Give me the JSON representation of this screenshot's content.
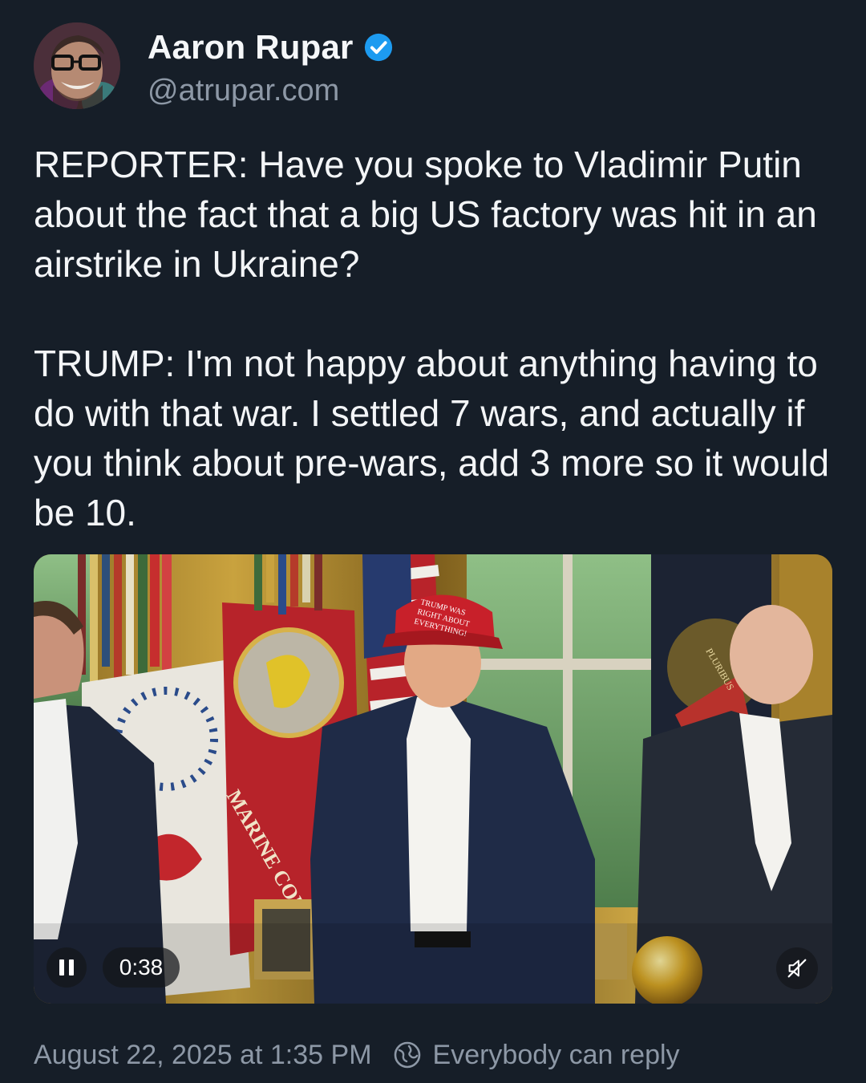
{
  "author": {
    "display_name": "Aaron Rupar",
    "handle": "@atrupar.com",
    "verified": true,
    "verified_color": "#1d9bf0"
  },
  "post": {
    "paragraphs": [
      "REPORTER: Have you spoke to Vladimir Putin about the fact that a big US factory was hit in an airstrike in Ukraine?",
      "TRUMP: I'm not happy about anything having to do with that war. I settled 7 wars, and actually if you think about pre-wars, add 3 more so it would be 10."
    ]
  },
  "video": {
    "elapsed": "0:38",
    "playing": true,
    "muted": true,
    "play_icon": "pause-icon",
    "mute_icon": "speaker-muted-icon",
    "scene_text": {
      "hat": [
        "TRUMP WAS",
        "RIGHT ABOUT",
        "EVERYTHING!"
      ],
      "flag_banner": "MARINE CORPS",
      "seal_word": "PLURIBUS"
    }
  },
  "footer": {
    "timestamp": "August 22, 2025 at 1:35 PM",
    "reply_setting": "Everybody can reply",
    "reply_icon": "globe-reply-icon"
  },
  "colors": {
    "background": "#161e28",
    "text": "#f3f5f7",
    "muted": "#8d98a6"
  }
}
